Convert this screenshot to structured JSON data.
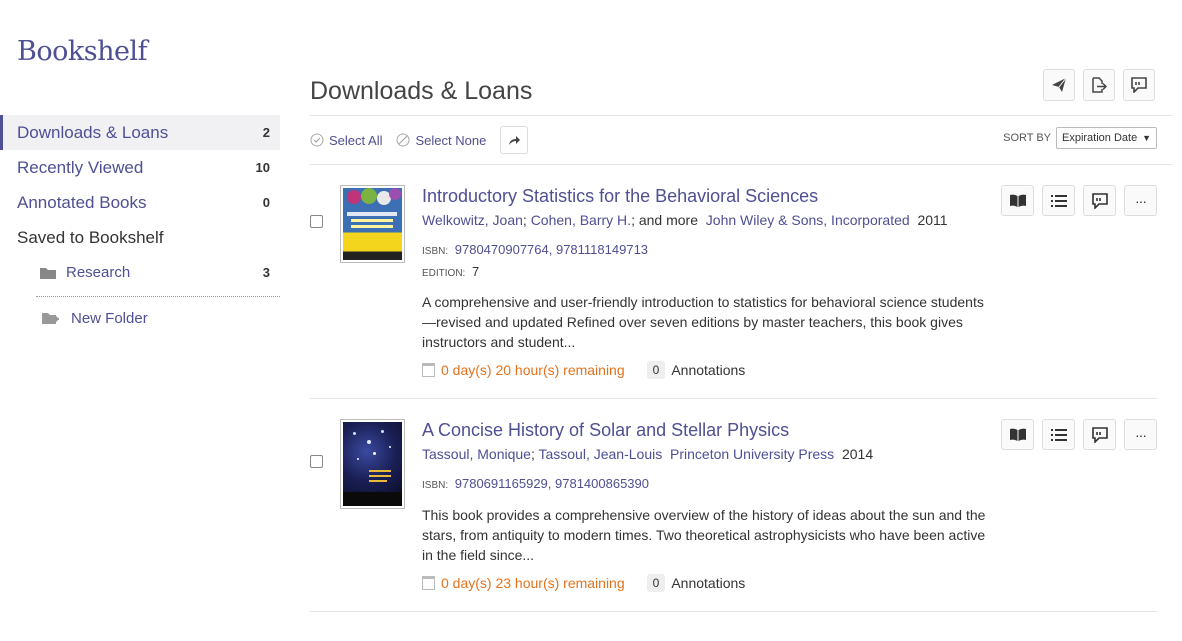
{
  "app": {
    "title": "Bookshelf"
  },
  "sidebar": {
    "items": [
      {
        "label": "Downloads & Loans",
        "count": "2",
        "active": true
      },
      {
        "label": "Recently Viewed",
        "count": "10"
      },
      {
        "label": "Annotated Books",
        "count": "0"
      }
    ],
    "saved_heading": "Saved to Bookshelf",
    "folders": [
      {
        "label": "Research",
        "count": "3",
        "icon": "folder-icon"
      }
    ],
    "new_folder": "New Folder"
  },
  "header": {
    "title": "Downloads & Loans",
    "actions": [
      "send-icon",
      "export-icon",
      "feedback-icon"
    ]
  },
  "toolbar": {
    "select_all": "Select All",
    "select_none": "Select None",
    "sort_label": "SORT BY",
    "sort_value": "Expiration Date"
  },
  "books": [
    {
      "title": "Introductory Statistics for the Behavioral Sciences",
      "authors": [
        "Welkowitz, Joan",
        "Cohen, Barry H."
      ],
      "and_more": "; and more",
      "publisher": "John Wiley & Sons, Incorporated",
      "year": "2011",
      "isbn_label": "ISBN:",
      "isbn": "9780470907764, 9781118149713",
      "edition_label": "EDITION:",
      "edition": "7",
      "description": "A comprehensive and user-friendly introduction to statistics for behavioral science students—revised and updated Refined over seven editions by master teachers, this book gives instructors and student...",
      "remaining": "0 day(s) 20 hour(s) remaining",
      "annotations_count": "0",
      "annotations_label": "Annotations"
    },
    {
      "title": "A Concise History of Solar and Stellar Physics",
      "authors": [
        "Tassoul, Monique",
        "Tassoul, Jean-Louis"
      ],
      "publisher": "Princeton University Press",
      "year": "2014",
      "isbn_label": "ISBN:",
      "isbn": "9780691165929, 9781400865390",
      "description": "This book provides a comprehensive overview of the history of ideas about the sun and the stars, from antiquity to modern times. Two theoretical astrophysicists who have been active in the field since...",
      "remaining": "0 day(s) 23 hour(s) remaining",
      "annotations_count": "0",
      "annotations_label": "Annotations"
    }
  ],
  "book_actions": [
    "open-book-icon",
    "contents-list-icon",
    "notes-icon",
    "more-icon"
  ],
  "colors": {
    "accent": "#4f4f93",
    "remaining": "#e3721e"
  }
}
